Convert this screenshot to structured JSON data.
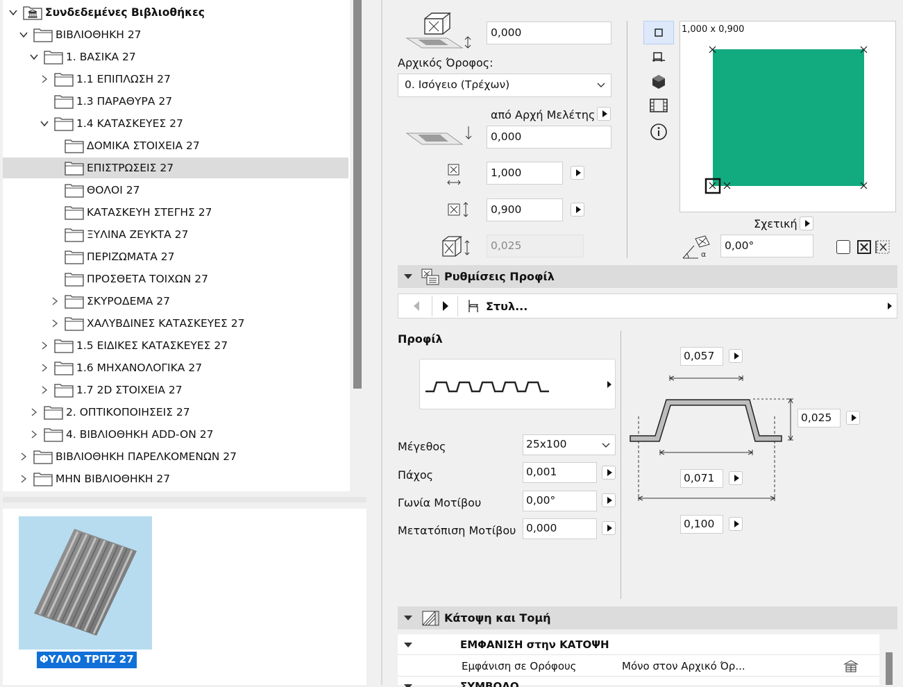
{
  "tree": {
    "root_label": "Συνδεδεμένες Βιβλιοθήκες",
    "items": [
      {
        "label": "ΒΙΒΛΙΟΘΗΚΗ 27",
        "level": 1,
        "state": "expanded"
      },
      {
        "label": "1. ΒΑΣΙΚΑ 27",
        "level": 2,
        "state": "expanded"
      },
      {
        "label": "1.1 ΕΠΙΠΛΩΣΗ 27",
        "level": 3,
        "state": "collapsed"
      },
      {
        "label": "1.3 ΠΑΡΑΘΥΡΑ 27",
        "level": 3,
        "state": "leaf"
      },
      {
        "label": "1.4 ΚΑΤΑΣΚΕΥΕΣ 27",
        "level": 3,
        "state": "expanded"
      },
      {
        "label": "ΔΟΜΙΚΑ ΣΤΟΙΧΕΙΑ 27",
        "level": 4,
        "state": "leaf"
      },
      {
        "label": "ΕΠΙΣΤΡΩΣΕΙΣ 27",
        "level": 4,
        "state": "leaf",
        "selected": true
      },
      {
        "label": "ΘΟΛΟΙ 27",
        "level": 4,
        "state": "leaf"
      },
      {
        "label": "ΚΑΤΑΣΚΕΥΗ ΣΤΕΓΗΣ 27",
        "level": 4,
        "state": "leaf"
      },
      {
        "label": "ΞΥΛΙΝΑ ΖΕΥΚΤΑ 27",
        "level": 4,
        "state": "leaf"
      },
      {
        "label": "ΠΕΡΙΖΩΜΑΤΑ 27",
        "level": 4,
        "state": "leaf"
      },
      {
        "label": "ΠΡΟΣΘΕΤΑ ΤΟΙΧΩΝ 27",
        "level": 4,
        "state": "leaf"
      },
      {
        "label": "ΣΚΥΡΟΔΕΜΑ 27",
        "level": 4,
        "state": "collapsed"
      },
      {
        "label": "ΧΑΛΥΒΔΙΝΕΣ ΚΑΤΑΣΚΕΥΕΣ 27",
        "level": 4,
        "state": "collapsed"
      },
      {
        "label": "1.5 ΕΙΔΙΚΕΣ ΚΑΤΑΣΚΕΥΕΣ 27",
        "level": 3,
        "state": "collapsed"
      },
      {
        "label": "1.6 ΜΗΧΑΝΟΛΟΓΙΚΑ 27",
        "level": 3,
        "state": "collapsed"
      },
      {
        "label": "1.7 2D ΣΤΟΙΧΕΙΑ 27",
        "level": 3,
        "state": "collapsed"
      },
      {
        "label": "2. ΟΠΤΙΚΟΠΟΙΗΣΕΙΣ 27",
        "level": 2,
        "state": "collapsed"
      },
      {
        "label": "4. ΒΙΒΛΙΟΘΗΚΗ ADD-ON 27",
        "level": 2,
        "state": "collapsed"
      },
      {
        "label": "ΒΙΒΛΙΟΘΗΚΗ ΠΑΡΕΛΚΟΜΕΝΩΝ 27",
        "level": 1,
        "state": "collapsed"
      },
      {
        "label": "ΜΗΝ ΒΙΒΛΙΟΘΗΚΗ 27",
        "level": 1,
        "state": "collapsed"
      }
    ]
  },
  "preview": {
    "object_name": "ΦΥΛΛΟ ΤΡΠΖ 27"
  },
  "geometry": {
    "elevation_value": "0,000",
    "home_story_label": "Αρχικός Όροφος:",
    "home_story_value": "0. Ισόγειο (Τρέχων)",
    "reference_label": "από Αρχή Μελέτης",
    "offset_value": "0,000",
    "width_value": "1,000",
    "depth_value": "0,900",
    "height_value": "0,025",
    "plan_size_text": "1,000 x 0,900",
    "relative_label": "Σχετική",
    "rotation_value": "0,00°"
  },
  "profile_section": {
    "title": "Ρυθμίσεις Προφίλ",
    "style_label": "Στυλ...",
    "profile_heading": "Προφίλ",
    "size_label": "Μέγεθος",
    "size_value": "25x100",
    "thickness_label": "Πάχος",
    "thickness_value": "0,001",
    "pattern_angle_label": "Γωνία Μοτίβου",
    "pattern_angle_value": "0,00°",
    "pattern_offset_label": "Μετατόπιση Μοτίβου",
    "pattern_offset_value": "0,000",
    "dim_top": "0,057",
    "dim_height": "0,025",
    "dim_bottom": "0,071",
    "dim_total": "0,100"
  },
  "plan_section": {
    "title": "Κάτοψη και Τομή",
    "group_label": "ΕΜΦΑΝΙΣΗ στην ΚΑΤΟΨΗ",
    "row_label": "Εμφάνιση σε Ορόφους",
    "row_value": "Μόνο στον Αρχικό Όρ...",
    "next_group_label": "ΣΥΜΒΟΛΟ"
  },
  "colors": {
    "plan_fill": "#12ab80",
    "selection": "#1170d8"
  }
}
